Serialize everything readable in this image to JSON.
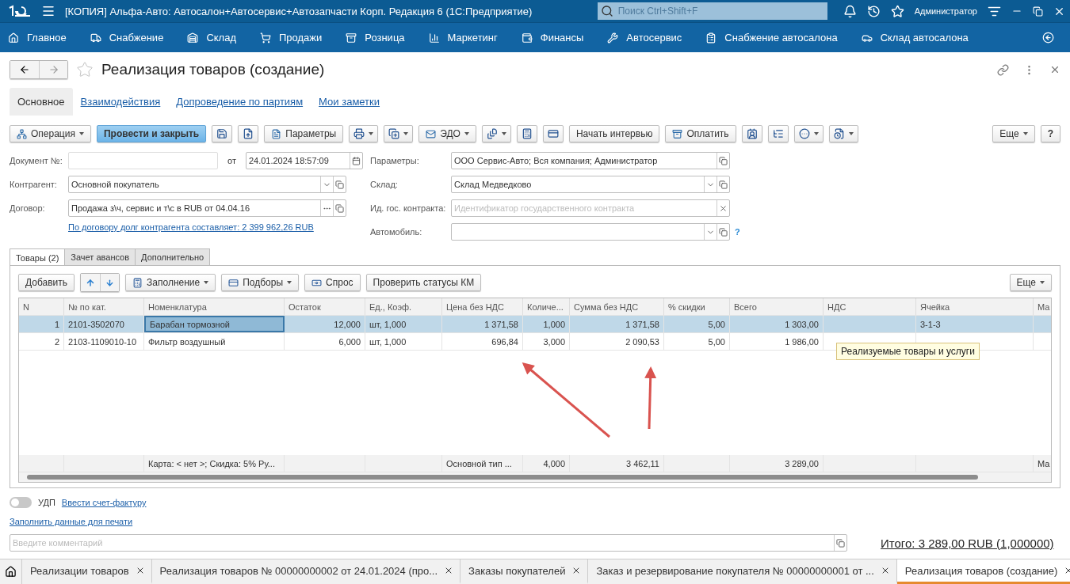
{
  "title_bar": {
    "title": "[КОПИЯ] Альфа-Авто: Автосалон+Автосервис+Автозапчасти Корп. Редакция 6  (1С:Предприятие)",
    "search": {
      "placeholder": "Поиск Ctrl+Shift+F"
    },
    "user": "Администратор"
  },
  "sections": [
    {
      "label": "Главное"
    },
    {
      "label": "Снабжение"
    },
    {
      "label": "Склад"
    },
    {
      "label": "Продажи"
    },
    {
      "label": "Розница"
    },
    {
      "label": "Маркетинг"
    },
    {
      "label": "Финансы"
    },
    {
      "label": "Автосервис"
    },
    {
      "label": "Снабжение автосалона"
    },
    {
      "label": "Склад автосалона"
    }
  ],
  "form": {
    "title": "Реализация товаров (создание)",
    "tabs": [
      {
        "label": "Основное",
        "selected": true
      },
      {
        "label": "Взаимодействия",
        "selected": false
      },
      {
        "label": "Допроведение по партиям",
        "selected": false
      },
      {
        "label": "Мои заметки",
        "selected": false
      }
    ],
    "toolbar": [
      {
        "kind": "button",
        "label": "Операция",
        "dropdown": true
      },
      {
        "kind": "primary",
        "label": "Провести и закрыть"
      },
      {
        "kind": "icon",
        "dropdown": false
      },
      {
        "kind": "icon",
        "dropdown": false
      },
      {
        "kind": "button",
        "label": "Параметры",
        "dropdown": false
      },
      {
        "kind": "icon",
        "dropdown": true
      },
      {
        "kind": "icon",
        "dropdown": true
      },
      {
        "kind": "button",
        "label": "ЭДО",
        "dropdown": true
      },
      {
        "kind": "icon",
        "dropdown": true
      },
      {
        "kind": "icon",
        "dropdown": false
      },
      {
        "kind": "icon",
        "dropdown": false
      },
      {
        "kind": "button",
        "label": "Начать интервью",
        "dropdown": false
      },
      {
        "kind": "button",
        "label": "Оплатить",
        "dropdown": false
      },
      {
        "kind": "icon",
        "dropdown": false
      },
      {
        "kind": "icon",
        "dropdown": false
      },
      {
        "kind": "icon",
        "dropdown": true
      },
      {
        "kind": "icon",
        "dropdown": true
      }
    ],
    "more": "Еще",
    "help": "?",
    "fields_left": [
      {
        "kind": "number",
        "label": "Документ №:",
        "date_label": "от",
        "date": "24.01.2024 18:57:09"
      },
      {
        "kind": "select",
        "label": "Контрагент:",
        "value": "Основной покупатель"
      },
      {
        "kind": "choice",
        "label": "Договор:",
        "value": "Продажа з\\ч, сервис и т\\с в RUB от 04.04.16"
      }
    ],
    "debt_link": "По договору долг контрагента составляет: 2 399 962,26 RUB",
    "fields_right": [
      {
        "kind": "open",
        "label": "Параметры:",
        "value": "ООО Сервис-Авто; Вся компания; Администратор"
      },
      {
        "kind": "select",
        "label": "Склад:",
        "value": "Склад Медведково"
      },
      {
        "kind": "clear",
        "label": "Ид. гос. контракта:",
        "placeholder": "Идентификатор государственного контракта"
      },
      {
        "kind": "select",
        "label": "Автомобиль:",
        "help": "?"
      }
    ]
  },
  "goods": {
    "tabs": [
      {
        "label": "Товары (2)",
        "selected": true
      },
      {
        "label": "Зачет авансов",
        "selected": false
      },
      {
        "label": "Дополнительно",
        "selected": false
      }
    ],
    "toolbar": [
      {
        "kind": "button",
        "label": "Добавить",
        "dropdown": false
      },
      {
        "kind": "arrows"
      },
      {
        "kind": "button",
        "label": "Заполнение",
        "dropdown": true
      },
      {
        "kind": "button",
        "label": "Подборы",
        "dropdown": true
      },
      {
        "kind": "button",
        "label": "Спрос",
        "dropdown": false
      },
      {
        "kind": "button",
        "label": "Проверить статусы КМ",
        "dropdown": false
      }
    ],
    "more": "Еще",
    "columns": [
      "N",
      "№ по кат.",
      "Номенклатура",
      "Остаток",
      "Ед., Коэф.",
      "Цена без НДС",
      "Количе...",
      "Сумма без НДС",
      "% скидки",
      "Всего",
      "НДС",
      "Ячейка",
      "Ма"
    ],
    "rows": [
      {
        "selected": true,
        "cells": [
          "1",
          "2101-3502070",
          "Барабан тормозной",
          "12,000",
          "шт, 1,000",
          "1 371,58",
          "1,000",
          "1 371,58",
          "5,00",
          "1 303,00",
          null,
          "3-1-3",
          null
        ]
      },
      {
        "selected": false,
        "cells": [
          "2",
          "2103-1109010-10",
          "Фильтр воздушный",
          "6,000",
          "шт, 1,000",
          "696,84",
          "3,000",
          "2 090,53",
          "5,00",
          "1 986,00",
          null,
          null,
          null
        ]
      }
    ],
    "footer": {
      "discount": "Карта: < нет >; Скидка: 5% Ру...",
      "price_type": "Основной тип ...",
      "quantity": "4,000",
      "amount": "3 462,11",
      "total": "3 289,00",
      "column_13": "Ма"
    },
    "tooltip": "Реализуемые товары и услуги"
  },
  "bottom": {
    "udp": {
      "label": "УДП",
      "on": false
    },
    "invoice_link": "Ввести счет-фактуру",
    "print_link": "Заполнить данные для печати",
    "comment": {
      "placeholder": "Введите комментарий"
    },
    "total": "Итого: 3 289,00 RUB (1,000000)"
  },
  "window_tabs": [
    {
      "label": "Реализации товаров",
      "selected": false
    },
    {
      "label": "Реализация товаров № 00000000002 от 24.01.2024 (про...",
      "selected": false
    },
    {
      "label": "Заказы покупателей",
      "selected": false
    },
    {
      "label": "Заказ и резервирование покупателя № 00000000001 от ...",
      "selected": false
    },
    {
      "label": "Реализация товаров (создание)",
      "selected": true
    }
  ]
}
